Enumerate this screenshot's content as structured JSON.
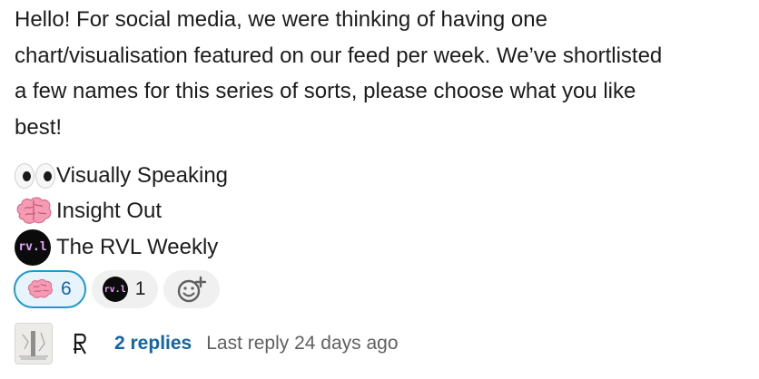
{
  "message": {
    "lines": [
      "Hello! For social media, we were thinking of having one",
      "chart/visualisation featured on our feed per week. We’ve shortlisted",
      "a few names for this series of sorts, please choose what you like",
      "best!"
    ]
  },
  "options": [
    {
      "icon": "eyes-emoji",
      "label": "Visually Speaking"
    },
    {
      "icon": "brain-emoji",
      "label": "Insight Out"
    },
    {
      "icon": "rvl-logo",
      "label": "The RVL Weekly"
    }
  ],
  "rvl_logo_text": "rv.l",
  "reactions": [
    {
      "icon": "brain-emoji",
      "count": "6",
      "selected": true
    },
    {
      "icon": "rvl-logo",
      "count": "1",
      "selected": false
    }
  ],
  "thread": {
    "replies": "2 replies",
    "last_reply": "Last reply 24 days ago"
  },
  "colors": {
    "link": "#1264a3",
    "selected_border": "#1d9bd1",
    "selected_bg": "#e8f4fb",
    "pill_bg": "#f0f0f0",
    "brain": "#f59bb3"
  }
}
